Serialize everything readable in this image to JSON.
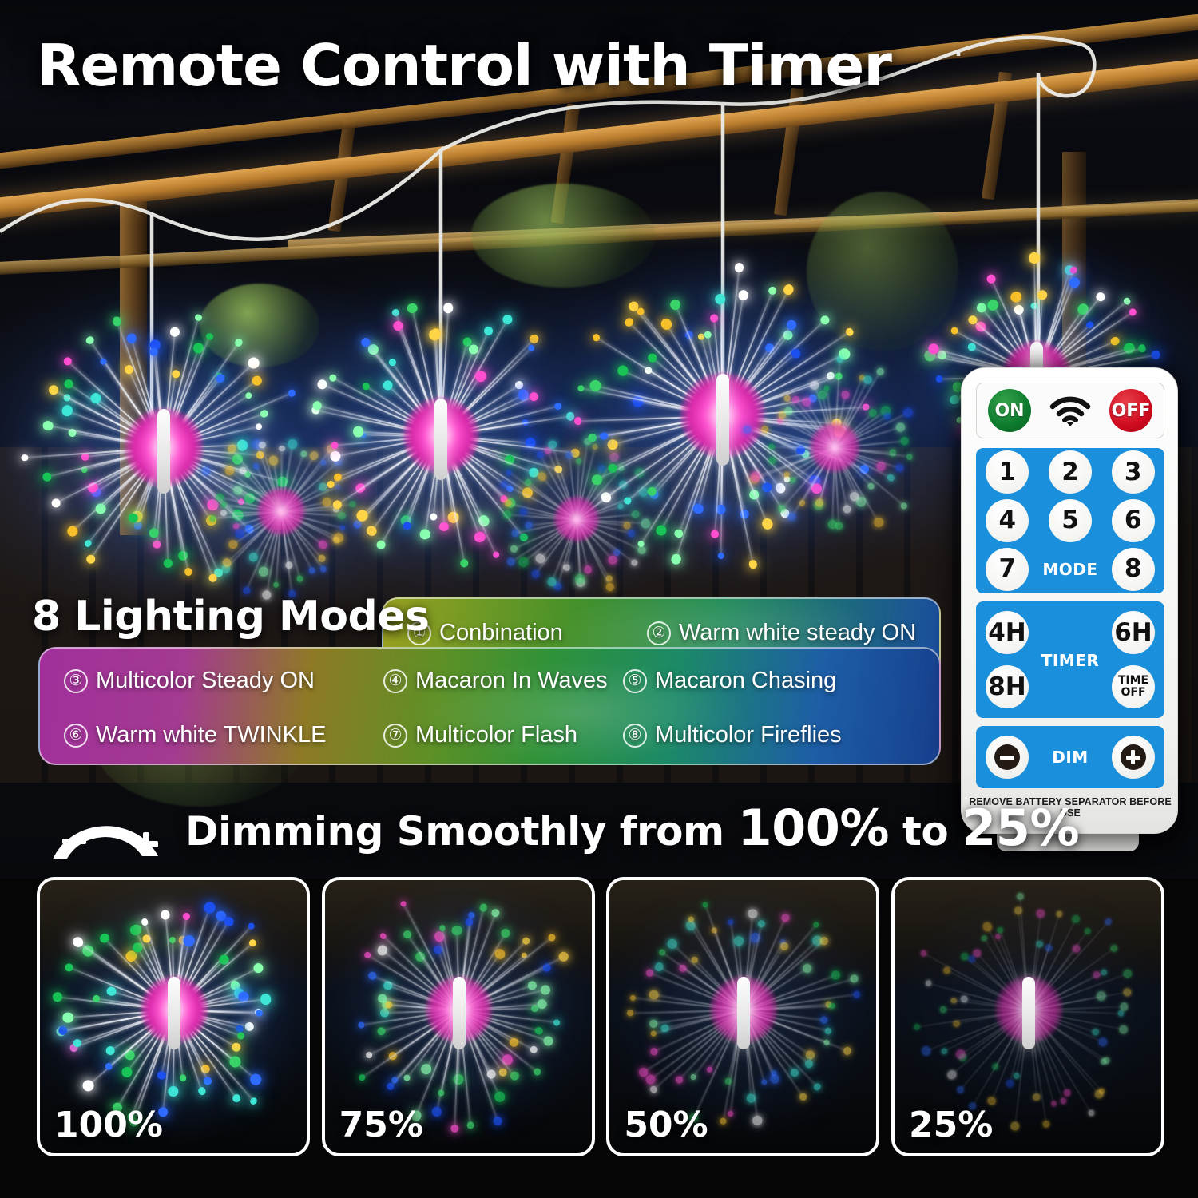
{
  "header": {
    "title": "Remote Control with Timer"
  },
  "modes": {
    "heading": "8 Lighting Modes",
    "items": [
      {
        "num": "①",
        "label": "Conbination"
      },
      {
        "num": "②",
        "label": "Warm white steady ON"
      },
      {
        "num": "③",
        "label": "Multicolor Steady ON"
      },
      {
        "num": "④",
        "label": "Macaron In Waves"
      },
      {
        "num": "⑤",
        "label": "Macaron Chasing"
      },
      {
        "num": "⑥",
        "label": "Warm white TWINKLE"
      },
      {
        "num": "⑦",
        "label": "Multicolor Flash"
      },
      {
        "num": "⑧",
        "label": "Multicolor Fireflies"
      }
    ]
  },
  "dimming": {
    "prefix": "Dimming Smoothly from",
    "from": "100%",
    "joiner": "to",
    "to": "25%",
    "minus_icon": "minus-icon",
    "plus_icon": "plus-icon",
    "arc_icon": "dimming-arc-icon"
  },
  "thumbnails": [
    {
      "label": "100%",
      "brightness": 100
    },
    {
      "label": "75%",
      "brightness": 75
    },
    {
      "label": "50%",
      "brightness": 50
    },
    {
      "label": "25%",
      "brightness": 25
    }
  ],
  "remote": {
    "power": {
      "on": "ON",
      "off": "OFF",
      "signal_icon": "wifi-signal-icon"
    },
    "mode_label": "MODE",
    "number_keys": [
      "1",
      "2",
      "3",
      "4",
      "5",
      "6",
      "7",
      "8"
    ],
    "timer": {
      "label": "TIMER",
      "keys": [
        "4H",
        "6H",
        "8H"
      ],
      "time_off": "TIME\nOFF",
      "time_off_line1": "TIME",
      "time_off_line2": "OFF"
    },
    "dim": {
      "label": "DIM",
      "minus_icon": "brightness-down-icon",
      "plus_icon": "brightness-up-icon"
    },
    "footer_note": "REMOVE BATTERY SEPARATOR BEFORE USE"
  },
  "colors": {
    "remote_blue": "#1a8fdc",
    "on_green": "#0c7a2d",
    "off_red": "#cf0a1e",
    "panel_magenta": "#a0309b",
    "panel_green": "#2f9238",
    "panel_blue": "#173f8e",
    "white": "#ffffff"
  }
}
